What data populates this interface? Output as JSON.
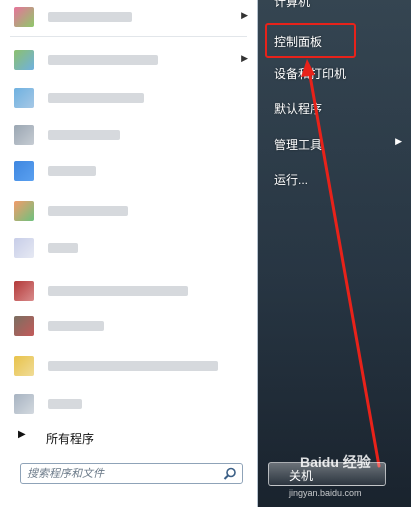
{
  "programs": [
    {
      "icon_color": "#d86a8e",
      "arrow": true
    },
    {
      "icon_color": "#8cc06d",
      "arrow": true
    },
    {
      "icon_color": "#7ab3d9",
      "arrow": false
    },
    {
      "icon_color": "#9aa6b2",
      "arrow": false
    },
    {
      "icon_color": "#3f87e0",
      "arrow": false
    },
    {
      "icon_color": "#f29b6a",
      "arrow": false
    },
    {
      "icon_color": "#c7cde8",
      "arrow": false
    },
    {
      "icon_color": "#b23a3a",
      "arrow": false
    },
    {
      "icon_color": "#7a6f61",
      "arrow": false
    },
    {
      "icon_color": "#e8c24a",
      "arrow": false
    },
    {
      "icon_color": "#a7b3c1",
      "arrow": false
    }
  ],
  "all_programs": "所有程序",
  "search": {
    "placeholder": "搜索程序和文件"
  },
  "right_menu": {
    "computer": "计算机",
    "control_panel": "控制面板",
    "devices": "设备和打印机",
    "default_programs": "默认程序",
    "admin_tools": "管理工具",
    "run": "运行..."
  },
  "shutdown_label": "关机",
  "watermark": {
    "brand": "Baidu 经验",
    "url": "jingyan.baidu.com"
  },
  "colors": {
    "highlight": "#e8221a",
    "arrow_line": "#e8221a"
  }
}
